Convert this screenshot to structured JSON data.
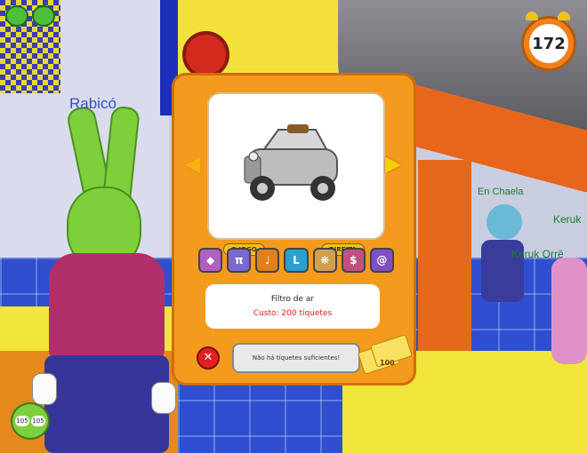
{
  "hud": {
    "timer_value": "172",
    "laff_current": "105",
    "laff_max": "105"
  },
  "nametags": {
    "player": "Rabicó",
    "toon_1": "En Chaela",
    "toon_2": "Keruk",
    "toon_3": "Keruk Orrê"
  },
  "shop": {
    "page_tab_left": "O JOGO",
    "page_tab_right": "DIREITA",
    "item_name": "Filtro de ar",
    "item_cost": "Custo: 200 tíquetes",
    "status_message": "Não há tíquetes suficientes!",
    "ticket_count": "100",
    "categories": [
      "gem-icon",
      "pi-icon",
      "horn-icon",
      "boot-icon",
      "wheel-icon",
      "dollar-icon",
      "swirl-icon"
    ]
  },
  "colors": {
    "panel": "#f49a1c",
    "cost_text": "#e01818",
    "nametag_player": "#3a4ec2",
    "nametag_other": "#1f7a32"
  }
}
